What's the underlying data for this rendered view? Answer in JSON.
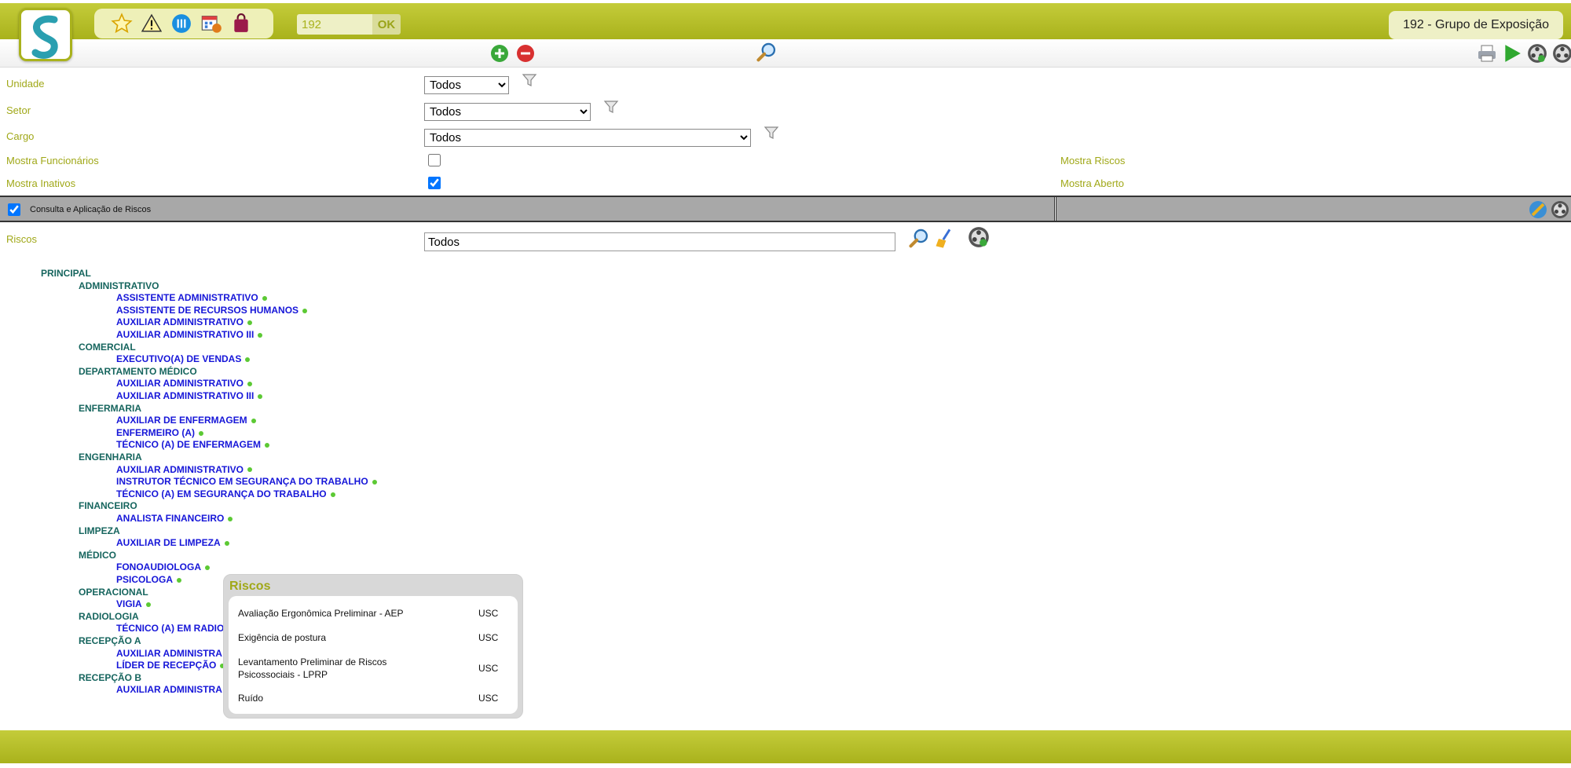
{
  "header": {
    "quick_search_value": "192",
    "ok_label": "OK",
    "screen_title": "192 - Grupo de Exposição",
    "toolbar_icons": [
      "star-icon",
      "warning-icon",
      "info-columns-icon",
      "calendar-icon",
      "bag-icon"
    ]
  },
  "form": {
    "unidade_label": "Unidade",
    "unidade_value": "Todos",
    "setor_label": "Setor",
    "setor_value": "Todos",
    "cargo_label": "Cargo",
    "cargo_value": "Todos",
    "mostra_funcionarios_label": "Mostra Funcionários",
    "mostra_funcionarios_checked": false,
    "mostra_inativos_label": "Mostra Inativos",
    "mostra_inativos_checked": true,
    "mostra_riscos_label": "Mostra Riscos",
    "mostra_aberto_label": "Mostra Aberto"
  },
  "section": {
    "title": "Consulta e Aplicação de Riscos",
    "checked": true
  },
  "riscos": {
    "label": "Riscos",
    "value": "Todos"
  },
  "tree": {
    "root": "PRINCIPAL",
    "groups": [
      {
        "name": "ADMINISTRATIVO",
        "items": [
          "ASSISTENTE ADMINISTRATIVO",
          "ASSISTENTE DE RECURSOS HUMANOS",
          "AUXILIAR ADMINISTRATIVO",
          "AUXILIAR ADMINISTRATIVO III"
        ]
      },
      {
        "name": "COMERCIAL",
        "items": [
          "EXECUTIVO(A) DE VENDAS"
        ]
      },
      {
        "name": "DEPARTAMENTO MÉDICO",
        "items": [
          "AUXILIAR ADMINISTRATIVO",
          "AUXILIAR ADMINISTRATIVO III"
        ]
      },
      {
        "name": "ENFERMARIA",
        "items": [
          "AUXILIAR DE ENFERMAGEM",
          "ENFERMEIRO (A)",
          "TÉCNICO (A) DE ENFERMAGEM"
        ]
      },
      {
        "name": "ENGENHARIA",
        "items": [
          "AUXILIAR ADMINISTRATIVO",
          "INSTRUTOR TÉCNICO EM SEGURANÇA DO TRABALHO",
          "TÉCNICO (A) EM SEGURANÇA DO TRABALHO"
        ]
      },
      {
        "name": "FINANCEIRO",
        "items": [
          "ANALISTA FINANCEIRO"
        ]
      },
      {
        "name": "LIMPEZA",
        "items": [
          "AUXILIAR DE LIMPEZA"
        ]
      },
      {
        "name": "MÉDICO",
        "items": [
          "FONOAUDIOLOGA",
          "PSICOLOGA"
        ]
      },
      {
        "name": "OPERACIONAL",
        "items": [
          "VIGIA"
        ]
      },
      {
        "name": "RADIOLOGIA",
        "items": [
          "TÉCNICO (A) EM RADIO"
        ]
      },
      {
        "name": "RECEPÇÃO A",
        "items": [
          "AUXILIAR ADMINISTRA",
          "LÍDER DE RECEPÇÃO"
        ]
      },
      {
        "name": "RECEPÇÃO B",
        "items": [
          "AUXILIAR ADMINISTRA"
        ]
      }
    ]
  },
  "popup": {
    "title": "Riscos",
    "rows": [
      {
        "name": "Avaliação Ergonômica Preliminar - AEP",
        "code": "USC"
      },
      {
        "name": "Exigência de postura",
        "code": "USC"
      },
      {
        "name": "Levantamento Preliminar de Riscos Psicossociais - LPRP",
        "code": "USC"
      },
      {
        "name": "Ruído",
        "code": "USC"
      }
    ]
  },
  "colors": {
    "brand_olive": "#a9b21c",
    "label_olive": "#a0a818",
    "tree_group": "#16655e",
    "tree_item": "#1616d8",
    "status_dot": "#5cc934"
  }
}
